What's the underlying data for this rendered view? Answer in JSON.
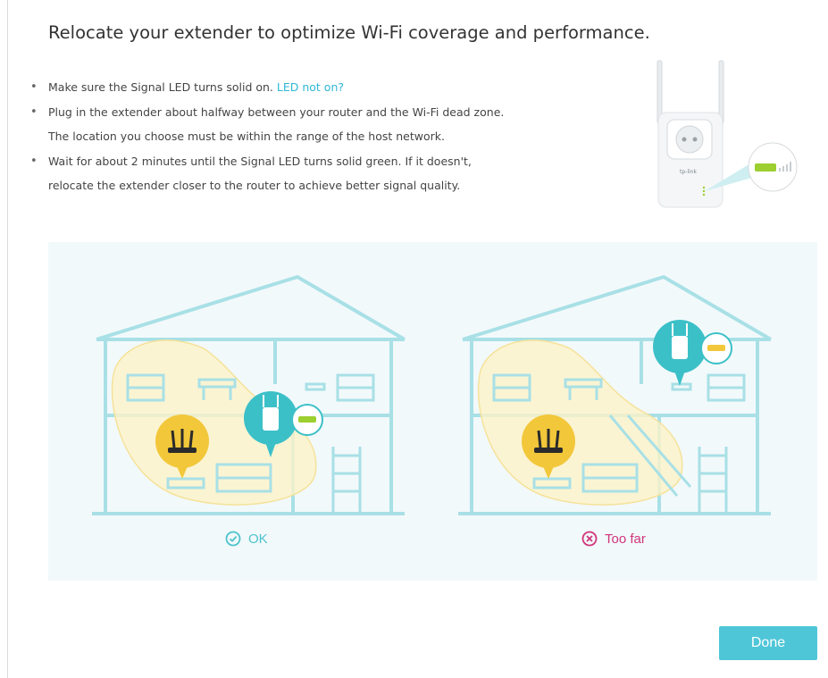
{
  "title": "Relocate your extender to optimize Wi-Fi coverage and performance.",
  "tips": {
    "item1_text": "Make sure the Signal LED turns solid on.",
    "item1_link": "LED not on?",
    "item2_line1": "Plug in the extender about halfway between your router and the Wi-Fi dead zone.",
    "item2_line2": "The location you choose must be within the range of the host network.",
    "item3_line1": "Wait for about 2 minutes until the Signal LED turns solid green. If it doesn't,",
    "item3_line2": "relocate the extender closer to the router to achieve better signal quality."
  },
  "extender_brand": "tp-link",
  "scenarios": {
    "ok": {
      "label": "OK",
      "status_color": "#4ec3cc",
      "icon": "check-circle-icon"
    },
    "far": {
      "label": "Too far",
      "status_color": "#d0357a",
      "icon": "x-circle-icon"
    }
  },
  "done_label": "Done",
  "colors": {
    "accent": "#4fc6d8",
    "house_line": "#a8e0e6",
    "coverage_fill": "#fdf3c8",
    "router_bubble": "#f2c73a",
    "extender_bubble": "#3cc0c8",
    "led_green": "#9ccf2f",
    "led_yellow": "#f2c73a"
  }
}
